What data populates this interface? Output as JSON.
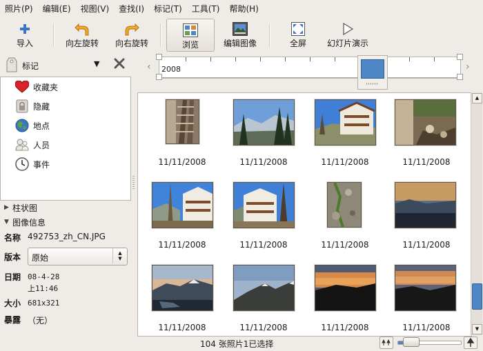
{
  "menu": [
    "照片(P)",
    "编辑(E)",
    "视图(V)",
    "查找(I)",
    "标记(T)",
    "工具(T)",
    "帮助(H)"
  ],
  "toolbar": {
    "import": "导入",
    "rotate_left": "向左旋转",
    "rotate_right": "向右旋转",
    "browse": "浏览",
    "edit_image": "编辑图像",
    "fullscreen": "全屏",
    "slideshow": "幻灯片演示"
  },
  "tag_selector": {
    "label": "标记"
  },
  "sidebar_items": [
    "收藏夹",
    "隐藏",
    "地点",
    "人员",
    "事件"
  ],
  "histogram_label": "柱状图",
  "image_info": {
    "header": "图像信息",
    "name_key": "名称",
    "name_val": "492753_zh_CN.JPG",
    "version_key": "版本",
    "version_val": "原始",
    "date_key": "日期",
    "date_val1": "08-4-28",
    "date_val2": "上11:46",
    "size_key": "大小",
    "size_val": "681x321",
    "exposure_key": "暴露",
    "exposure_val": "（无）"
  },
  "timeline": {
    "year": "2008"
  },
  "photos": [
    {
      "date": "11/11/2008",
      "kind": "tall"
    },
    {
      "date": "11/11/2008",
      "kind": "wide"
    },
    {
      "date": "11/11/2008",
      "kind": "wide"
    },
    {
      "date": "11/11/2008",
      "kind": "wide"
    },
    {
      "date": "11/11/2008",
      "kind": "wide"
    },
    {
      "date": "11/11/2008",
      "kind": "wide"
    },
    {
      "date": "11/11/2008",
      "kind": "tall"
    },
    {
      "date": "11/11/2008",
      "kind": "wide"
    },
    {
      "date": "11/11/2008",
      "kind": "wide"
    },
    {
      "date": "11/11/2008",
      "kind": "wide"
    },
    {
      "date": "11/11/2008",
      "kind": "wide"
    },
    {
      "date": "11/11/2008",
      "kind": "wide"
    }
  ],
  "status": "104 张照片1已选择",
  "zoom_level": 0.12,
  "scroll_position": 0.92
}
